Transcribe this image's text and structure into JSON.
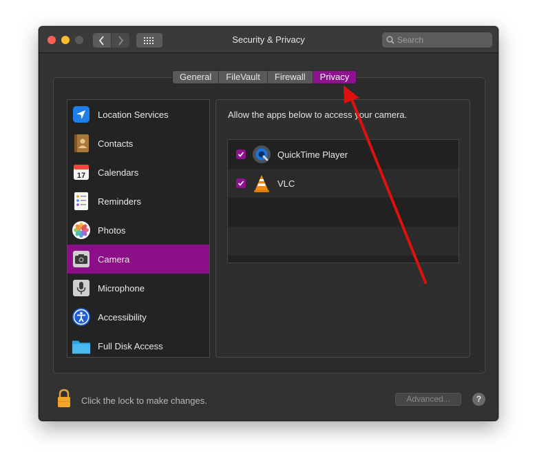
{
  "window": {
    "title": "Security & Privacy",
    "search_placeholder": "Search"
  },
  "tabs": [
    {
      "label": "General",
      "active": false
    },
    {
      "label": "FileVault",
      "active": false
    },
    {
      "label": "Firewall",
      "active": false
    },
    {
      "label": "Privacy",
      "active": true
    }
  ],
  "sidebar": {
    "items": [
      {
        "label": "Location Services",
        "icon": "location-arrow-icon"
      },
      {
        "label": "Contacts",
        "icon": "contacts-book-icon"
      },
      {
        "label": "Calendars",
        "icon": "calendar-icon"
      },
      {
        "label": "Reminders",
        "icon": "reminders-list-icon"
      },
      {
        "label": "Photos",
        "icon": "photos-flower-icon"
      },
      {
        "label": "Camera",
        "icon": "camera-icon",
        "selected": true
      },
      {
        "label": "Microphone",
        "icon": "microphone-icon"
      },
      {
        "label": "Accessibility",
        "icon": "accessibility-icon"
      },
      {
        "label": "Full Disk Access",
        "icon": "folder-icon"
      }
    ]
  },
  "content": {
    "description": "Allow the apps below to access your camera.",
    "apps": [
      {
        "name": "QuickTime Player",
        "checked": true,
        "icon": "quicktime-icon"
      },
      {
        "name": "VLC",
        "checked": true,
        "icon": "vlc-cone-icon"
      }
    ]
  },
  "footer": {
    "lock_text": "Click the lock to make changes.",
    "advanced_label": "Advanced...",
    "help_label": "?"
  },
  "colors": {
    "accent": "#8f1191",
    "annotation_arrow": "#e01010"
  }
}
